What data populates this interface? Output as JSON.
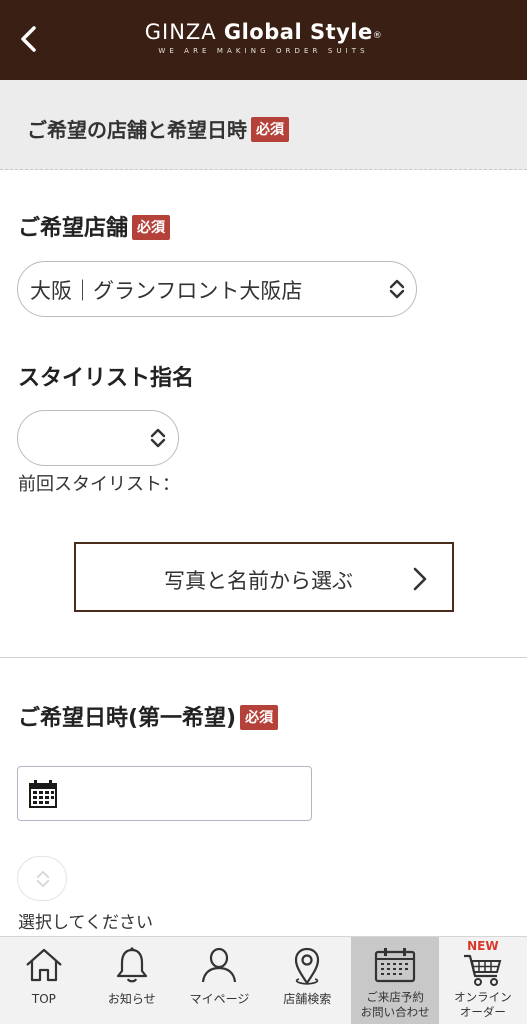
{
  "header": {
    "logo_thin": "GINZA",
    "logo_bold": "Global Style",
    "logo_reg": "®",
    "tagline": "WE ARE MAKING ORDER SUITS"
  },
  "section": {
    "title": "ご希望の店舗と希望日時",
    "required_badge": "必須"
  },
  "store": {
    "label": "ご希望店舗",
    "required_badge": "必須",
    "selected_value": "大阪｜グランフロント大阪店"
  },
  "stylist": {
    "label": "スタイリスト指名",
    "selected_value": "",
    "previous_label": "前回スタイリスト：",
    "photo_button": "写真と名前から選ぶ"
  },
  "first_choice": {
    "label": "ご希望日時(第一希望)",
    "required_badge": "必須",
    "date_value": "",
    "time_hint": "選択してください"
  },
  "bottom_nav": {
    "items": [
      {
        "label": "TOP",
        "icon": "home-icon"
      },
      {
        "label": "お知らせ",
        "icon": "bell-icon"
      },
      {
        "label": "マイページ",
        "icon": "person-icon"
      },
      {
        "label": "店舗検索",
        "icon": "map-pin-icon"
      },
      {
        "label_line1": "ご来店予約",
        "label_line2": "お問い合わせ",
        "icon": "calendar-icon",
        "active": true
      },
      {
        "new_tag": "NEW",
        "label_line1": "オンライン",
        "label_line2": "オーダー",
        "icon": "cart-icon"
      }
    ]
  },
  "colors": {
    "header_bg": "#3a2014",
    "badge": "#b5423a",
    "new_tag": "#d9382a",
    "button_border": "#4a2a1b"
  }
}
